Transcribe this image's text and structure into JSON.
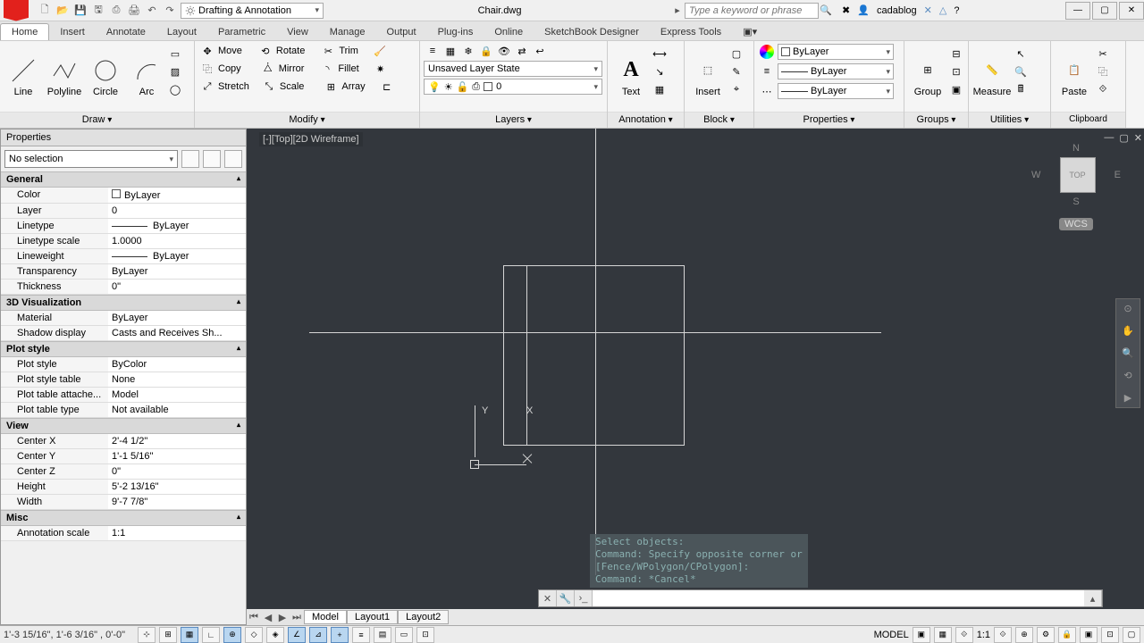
{
  "title": {
    "filename": "Chair.dwg",
    "workspace": "Drafting & Annotation",
    "search_placeholder": "Type a keyword or phrase",
    "user": "cadablog"
  },
  "tabs": [
    "Home",
    "Insert",
    "Annotate",
    "Layout",
    "Parametric",
    "View",
    "Manage",
    "Output",
    "Plug-ins",
    "Online",
    "SketchBook Designer",
    "Express Tools"
  ],
  "active_tab": "Home",
  "ribbon": {
    "draw": {
      "title": "Draw",
      "line": "Line",
      "polyline": "Polyline",
      "circle": "Circle",
      "arc": "Arc"
    },
    "modify": {
      "title": "Modify",
      "move": "Move",
      "rotate": "Rotate",
      "trim": "Trim",
      "copy": "Copy",
      "mirror": "Mirror",
      "fillet": "Fillet",
      "stretch": "Stretch",
      "scale": "Scale",
      "array": "Array"
    },
    "layers": {
      "title": "Layers",
      "state": "Unsaved Layer State",
      "current": "0"
    },
    "annotation": {
      "title": "Annotation",
      "text": "Text"
    },
    "block": {
      "title": "Block",
      "insert": "Insert"
    },
    "properties": {
      "title": "Properties",
      "color": "ByLayer",
      "ltype": "ByLayer",
      "lweight": "ByLayer"
    },
    "groups": {
      "title": "Groups",
      "group": "Group"
    },
    "utilities": {
      "title": "Utilities",
      "measure": "Measure"
    },
    "clipboard": {
      "title": "Clipboard",
      "paste": "Paste"
    }
  },
  "palette": {
    "title": "Properties",
    "selection": "No selection",
    "sections": {
      "General": [
        [
          "Color",
          "ByLayer"
        ],
        [
          "Layer",
          "0"
        ],
        [
          "Linetype",
          "ByLayer"
        ],
        [
          "Linetype scale",
          "1.0000"
        ],
        [
          "Lineweight",
          "ByLayer"
        ],
        [
          "Transparency",
          "ByLayer"
        ],
        [
          "Thickness",
          "0\""
        ]
      ],
      "3D Visualization": [
        [
          "Material",
          "ByLayer"
        ],
        [
          "Shadow display",
          "Casts and Receives Sh..."
        ]
      ],
      "Plot style": [
        [
          "Plot style",
          "ByColor"
        ],
        [
          "Plot style table",
          "None"
        ],
        [
          "Plot table attache...",
          "Model"
        ],
        [
          "Plot table type",
          "Not available"
        ]
      ],
      "View": [
        [
          "Center X",
          "2'-4 1/2\""
        ],
        [
          "Center Y",
          "1'-1 5/16\""
        ],
        [
          "Center Z",
          "0\""
        ],
        [
          "Height",
          "5'-2 13/16\""
        ],
        [
          "Width",
          "9'-7 7/8\""
        ]
      ],
      "Misc": [
        [
          "Annotation scale",
          "1:1"
        ]
      ]
    }
  },
  "viewport": {
    "label": "[-][Top][2D Wireframe]",
    "viewcube": {
      "top": "TOP",
      "n": "N",
      "s": "S",
      "e": "E",
      "w": "W",
      "wcs": "WCS"
    },
    "ucs": {
      "x": "X",
      "y": "Y"
    },
    "command_history": "Select objects:\nCommand: Specify opposite corner or\n[Fence/WPolygon/CPolygon]:\nCommand: *Cancel*"
  },
  "layout_tabs": [
    "Model",
    "Layout1",
    "Layout2"
  ],
  "status": {
    "coords": "1'-3 15/16\",  1'-6 3/16\" , 0'-0\"",
    "model": "MODEL",
    "scale": "1:1"
  }
}
